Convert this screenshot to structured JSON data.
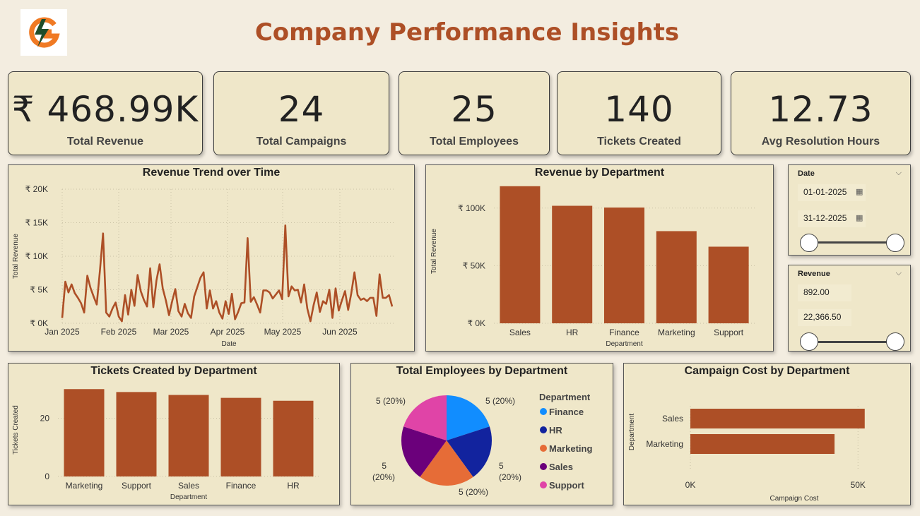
{
  "header": {
    "title": "Company Performance Insights",
    "logo_icon": "lightning-g-logo"
  },
  "colors": {
    "accent": "#ad4f26",
    "panel_bg": "#efe7c9",
    "page_bg": "#f3ede0"
  },
  "kpis": [
    {
      "value": "₹ 468.99K",
      "label": "Total Revenue"
    },
    {
      "value": "24",
      "label": "Total Campaigns"
    },
    {
      "value": "25",
      "label": "Total Employees"
    },
    {
      "value": "140",
      "label": "Tickets Created"
    },
    {
      "value": "12.73",
      "label": "Avg Resolution Hours"
    }
  ],
  "slicers": {
    "date": {
      "title": "Date",
      "start": "01-01-2025",
      "end": "31-12-2025"
    },
    "revenue": {
      "title": "Revenue",
      "min": "892.00",
      "max": "22,366.50"
    }
  },
  "chart_data": [
    {
      "type": "line",
      "title": "Revenue Trend over Time",
      "xlabel": "Date",
      "ylabel": "Total Revenue",
      "y_ticks": [
        "₹ 0K",
        "₹ 5K",
        "₹ 10K",
        "₹ 15K",
        "₹ 20K"
      ],
      "x_ticks": [
        "Jan 2025",
        "Feb 2025",
        "Mar 2025",
        "Apr 2025",
        "May 2025",
        "Jun 2025"
      ],
      "ylim": [
        0,
        20000
      ],
      "grid": true,
      "series": [
        {
          "color": "#ad4f26",
          "values": [
            800,
            6200,
            4600,
            5800,
            4500,
            3800,
            3000,
            1600,
            7100,
            5300,
            4000,
            2800,
            7800,
            13400,
            1600,
            1000,
            2200,
            3100,
            1000,
            300,
            4200,
            1300,
            5000,
            2600,
            7200,
            4800,
            3500,
            2500,
            8200,
            2400,
            6400,
            8800,
            5200,
            3400,
            1200,
            3300,
            5100,
            1800,
            1000,
            2900,
            1500,
            800,
            4000,
            5400,
            6800,
            7600,
            2200,
            4900,
            2200,
            3300,
            1600,
            700,
            3300,
            1400,
            4400,
            600,
            1700,
            3000,
            3100,
            12700,
            3200,
            3900,
            2800,
            1600,
            4900,
            4900,
            4600,
            3700,
            4300,
            4900,
            3600,
            14600,
            4000,
            5500,
            4900,
            5000,
            3100,
            5800,
            2200,
            300,
            2700,
            4600,
            1700,
            3300,
            2900,
            5000,
            800,
            5200,
            1900,
            3400,
            4800,
            2000,
            4500,
            7600,
            4200,
            3500,
            3700,
            3300,
            3800,
            3800,
            1100,
            7300,
            3800,
            3800,
            4200,
            2500
          ]
        }
      ]
    },
    {
      "type": "bar",
      "title": "Revenue by Department",
      "xlabel": "Department",
      "ylabel": "Total Revenue",
      "categories": [
        "Sales",
        "HR",
        "Finance",
        "Marketing",
        "Support"
      ],
      "values": [
        119000,
        102000,
        100500,
        80000,
        66500
      ],
      "y_ticks": [
        "₹ 0K",
        "₹ 50K",
        "₹ 100K"
      ],
      "ylim": [
        0,
        125000
      ]
    },
    {
      "type": "bar",
      "title": "Tickets Created by Department",
      "xlabel": "Department",
      "ylabel": "Tickets Created",
      "categories": [
        "Marketing",
        "Support",
        "Sales",
        "Finance",
        "HR"
      ],
      "values": [
        30,
        29,
        28,
        27,
        26
      ],
      "y_ticks": [
        "0",
        "20"
      ],
      "ylim": [
        0,
        32
      ]
    },
    {
      "type": "pie",
      "title": "Total Employees by Department",
      "legend_title": "Department",
      "legend_position": "right",
      "categories": [
        "Finance",
        "HR",
        "Marketing",
        "Sales",
        "Support"
      ],
      "values": [
        5,
        5,
        5,
        5,
        5
      ],
      "data_labels": [
        "5 (20%)",
        "5 (20%)",
        "5 (20%)",
        "5 (20%)",
        "5 (20%)"
      ],
      "colors": [
        "#118dff",
        "#12239e",
        "#e66c37",
        "#6b007b",
        "#e044a7"
      ]
    },
    {
      "type": "bar",
      "orientation": "horizontal",
      "title": "Campaign Cost by Department",
      "xlabel": "Campaign Cost",
      "ylabel": "Department",
      "categories": [
        "Sales",
        "Marketing"
      ],
      "values": [
        52000,
        43000
      ],
      "x_ticks": [
        "0K",
        "50K"
      ],
      "xlim": [
        0,
        55000
      ]
    }
  ]
}
